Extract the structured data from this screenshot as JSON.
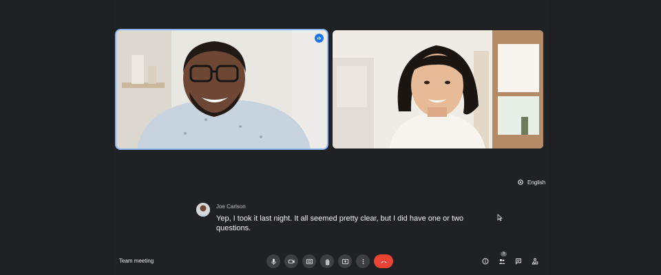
{
  "meeting": {
    "title": "Team meeting"
  },
  "participants": [
    {
      "name": "Joe Carlson",
      "speaking": true
    },
    {
      "name": "",
      "speaking": false
    }
  ],
  "captions": {
    "language": "English",
    "speaker": "Joe Carlson",
    "text": "Yep, I took it last night. It all seemed pretty clear, but I did have one or two questions."
  },
  "controls": [
    {
      "icon": "microphone-icon"
    },
    {
      "icon": "camera-icon"
    },
    {
      "icon": "captions-icon"
    },
    {
      "icon": "raise-hand-icon"
    },
    {
      "icon": "present-screen-icon"
    },
    {
      "icon": "more-options-icon"
    },
    {
      "icon": "end-call-icon",
      "color": "#ea4335"
    }
  ],
  "side_panel": {
    "people_count": "3",
    "icons": [
      "meeting-info-icon",
      "people-icon",
      "chat-icon",
      "activities-icon"
    ]
  },
  "colors": {
    "background": "#202124",
    "accent": "#8ab4f8",
    "end_call": "#ea4335"
  }
}
